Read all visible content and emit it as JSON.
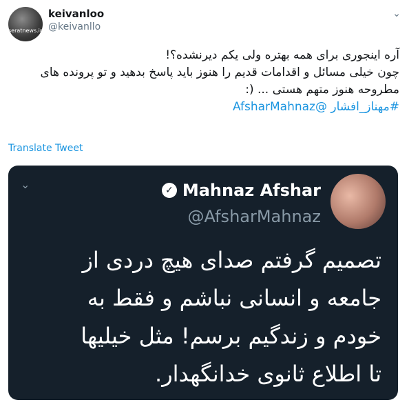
{
  "author": {
    "display_name": "keivanloo",
    "handle": "@keivanllo",
    "avatar_watermark": "seratnews.ir"
  },
  "tweet": {
    "lines": [
      "آره اینجوری برای همه بهتره ولی یکم دیرنشده؟!",
      "چون خیلی مسائل و اقدامات قدیم را هنوز  باید پاسخ بدهید و تو  پرونده های",
      "مطروحه هنوز متهم هستی ...  (:"
    ],
    "hashtags_line": "#مهناز_افشار @AfsharMahnaz"
  },
  "translate_label": "Translate Tweet",
  "embedded": {
    "name": "Mahnaz Afshar",
    "handle": "@AfsharMahnaz",
    "lines": [
      "تصمیم گرفتم صدای هیچ دردی از",
      "جامعه و انسانی نباشم و فقط به",
      "خودم و زندگیم برسم! مثل خیلیها",
      "تا اطلاع ثانوی خدانگهدار."
    ]
  },
  "icons": {
    "caret": "chevron-down-icon",
    "verified": "verified-badge-icon"
  },
  "colors": {
    "link": "#1b95e0",
    "secondary_text": "#657786",
    "embed_background": "#15202b"
  }
}
